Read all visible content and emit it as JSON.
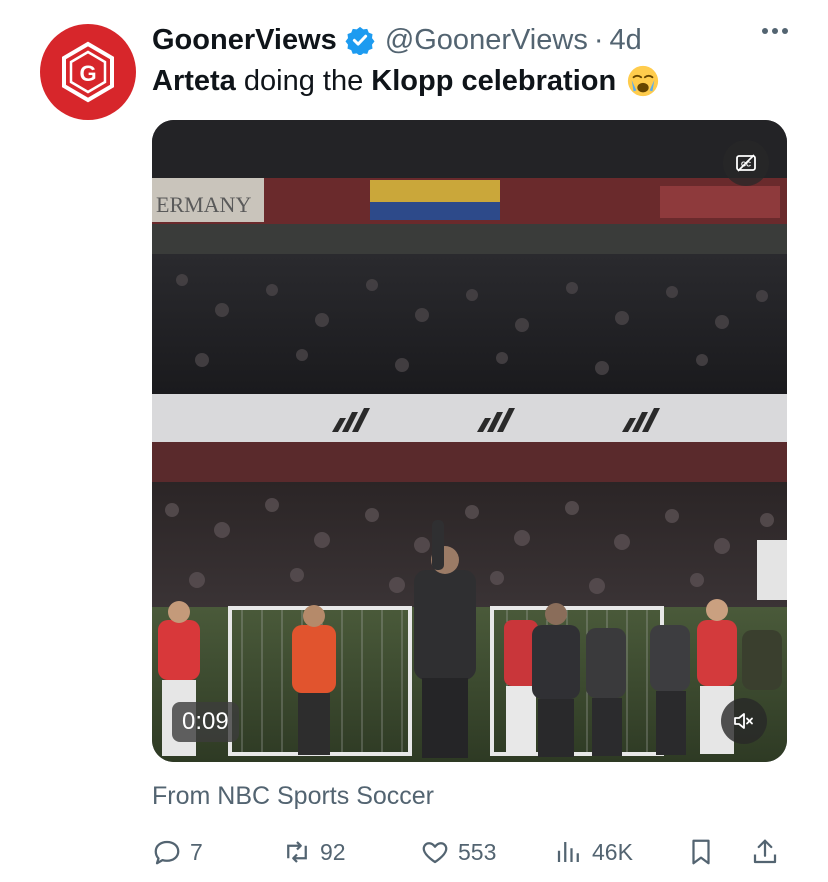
{
  "author": {
    "display_name": "GoonerViews",
    "handle": "@GoonerViews",
    "separator": "·",
    "time": "4d",
    "verified_icon": "verified-badge-icon",
    "avatar_icon": "gooner-views-logo"
  },
  "tweet": {
    "text_parts": {
      "p1": "Arteta",
      "p2": " doing the ",
      "p3": "Klopp celebration"
    },
    "emoji": "loudly-crying-face-icon"
  },
  "media": {
    "duration": "0:09",
    "banner_text": "ERMANY",
    "cc_icon": "captions-off-icon",
    "mute_icon": "speaker-muted-icon"
  },
  "source": "From NBC Sports Soccer",
  "actions": {
    "reply_count": "7",
    "retweet_count": "92",
    "like_count": "553",
    "views_count": "46K"
  },
  "colors": {
    "brand_red": "#d7262b",
    "verified_blue": "#1d9bf0",
    "muted_text": "#536471"
  }
}
